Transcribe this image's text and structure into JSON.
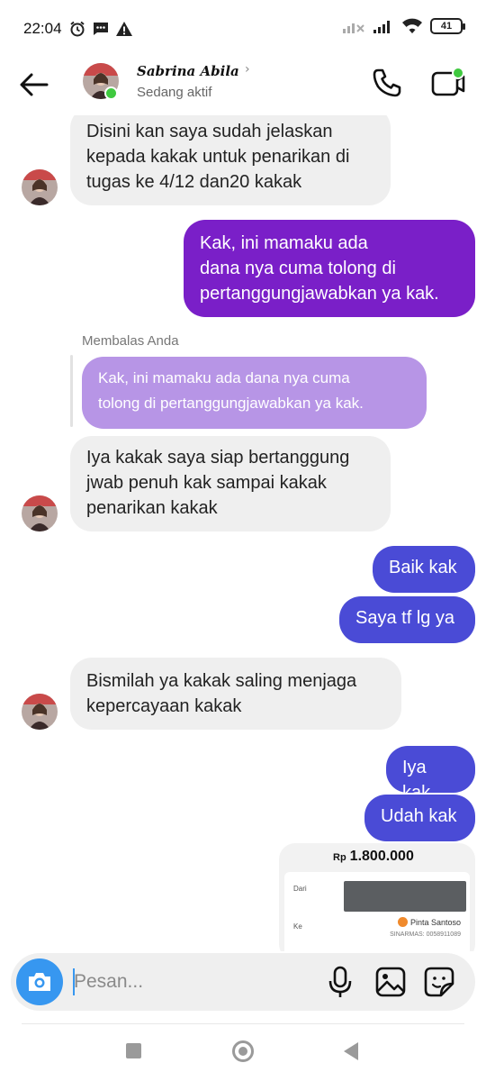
{
  "status_bar": {
    "time": "22:04",
    "battery": "41",
    "icons": [
      "alarm-icon",
      "message-icon",
      "warning-icon",
      "signal-off-icon",
      "signal-icon",
      "wifi-icon",
      "battery-icon"
    ]
  },
  "header": {
    "contact_name": "Sabrina Abila",
    "status": "Sedang aktif",
    "online_color": "#3fc93f"
  },
  "messages": [
    {
      "from": "them",
      "text": "Disini kan saya sudah jelaskan\nkepada kakak untuk penarikan di\ntugas ke 4/12 dan20 kakak"
    },
    {
      "from": "me",
      "text": "Kak, ini mamaku ada\ndana nya cuma tolong di\npertanggungjawabkan ya kak.",
      "color": "#7a1fc8"
    },
    {
      "from": "them",
      "reply_label": "Membalas Anda",
      "quoted": "Kak, ini mamaku ada dana nya cuma\ntolong di pertanggungjawabkan ya kak.",
      "text": "Iya kakak saya siap bertanggung\njwab penuh kak sampai kakak\npenarikan kakak"
    },
    {
      "from": "me",
      "text": "Baik kak",
      "color": "#4a4bd6"
    },
    {
      "from": "me",
      "text": "Saya tf lg ya",
      "color": "#4a4bd6"
    },
    {
      "from": "them",
      "text": "Bismilah ya kakak saling menjaga\nkepercayaan kakak"
    },
    {
      "from": "me",
      "text": "Iya kak",
      "color": "#4a4bd6"
    },
    {
      "from": "me",
      "text": "Udah kak",
      "color": "#4a4bd6"
    }
  ],
  "receipt": {
    "currency": "Rp",
    "amount": "1.800.000",
    "from_label": "Dari",
    "to_label": "Ke",
    "recipient": "Pinta Santoso",
    "account": "SINARMAS: 0058911089"
  },
  "composer": {
    "placeholder": "Pesan...",
    "accent": "#3797f0"
  }
}
